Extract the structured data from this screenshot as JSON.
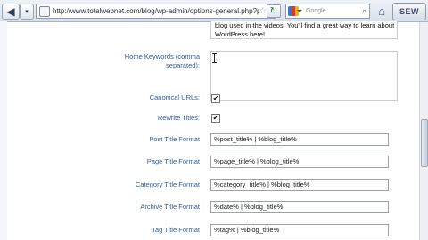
{
  "browser": {
    "back_arrow": "◀",
    "url": "http://www.totalwebnet.com/blog/wp-admin/options-general.php?page=all-",
    "search_placeholder": "Google",
    "seo_button": "SEW"
  },
  "form": {
    "description_lines": [
      "blog used in the videos.  You'll find a great way to learn about",
      "WordPress here!"
    ],
    "home_keywords_label_line1": "Home Keywords (comma",
    "home_keywords_label_line2": "separated):",
    "home_keywords_value": "",
    "canonical_urls_label": "Canonical URLs:",
    "canonical_urls_checked": "✔",
    "rewrite_titles_label": "Rewrite Titles:",
    "rewrite_titles_checked": "✔",
    "post_title_label": "Post Title Format",
    "post_title_value": "%post_title% | %blog_title%",
    "page_title_label": "Page Title Format",
    "page_title_value": "%page_title% | %blog_title%",
    "category_title_label": "Category Title Format",
    "category_title_value": "%category_title% | %blog_title%",
    "archive_title_label": "Archive Title Format",
    "archive_title_value": "%date% | %blog_title%",
    "tag_title_label": "Tag Title Format",
    "tag_title_value": "%tag% | %blog_title%"
  },
  "colors": {
    "label": "#2b5f9a",
    "toolbar": "#dfe5ee"
  }
}
